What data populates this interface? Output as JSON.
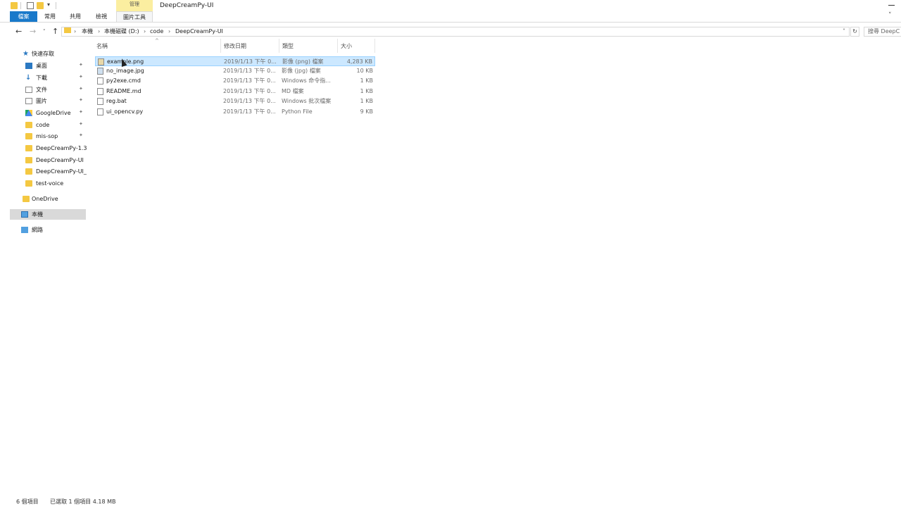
{
  "window": {
    "title": "DeepCreamPy-UI",
    "context_tab_label": "管理"
  },
  "ribbon": {
    "tabs": [
      {
        "label": "檔案"
      },
      {
        "label": "常用"
      },
      {
        "label": "共用"
      },
      {
        "label": "檢視"
      },
      {
        "label": "圖片工具"
      }
    ]
  },
  "address": {
    "breadcrumbs": [
      {
        "label": "本機"
      },
      {
        "label": "本機磁碟 (D:)"
      },
      {
        "label": "code"
      },
      {
        "label": "DeepCreamPy-UI"
      }
    ],
    "search_placeholder": "搜尋 DeepC"
  },
  "nav": {
    "quick_access": "快速存取",
    "items": [
      {
        "label": "桌面",
        "icon": "desktop-icon",
        "pinned": true
      },
      {
        "label": "下載",
        "icon": "download-icon",
        "pinned": true
      },
      {
        "label": "文件",
        "icon": "document-icon",
        "pinned": true
      },
      {
        "label": "圖片",
        "icon": "pictures-icon",
        "pinned": true
      },
      {
        "label": "GoogleDrive",
        "icon": "google-drive-icon",
        "pinned": true
      },
      {
        "label": "code",
        "icon": "folder-icon",
        "pinned": true
      },
      {
        "label": "mis-sop",
        "icon": "folder-icon",
        "pinned": true
      },
      {
        "label": "DeepCreamPy-1.3",
        "icon": "folder-icon",
        "pinned": false
      },
      {
        "label": "DeepCreamPy-UI",
        "icon": "folder-icon",
        "pinned": false
      },
      {
        "label": "DeepCreamPy-UI_",
        "icon": "folder-icon",
        "pinned": false
      },
      {
        "label": "test-voice",
        "icon": "folder-icon",
        "pinned": false
      }
    ],
    "onedrive": "OneDrive",
    "this_pc": "本機",
    "network": "網路"
  },
  "columns": {
    "name": "名稱",
    "modified": "修改日期",
    "type": "類型",
    "size": "大小"
  },
  "files": [
    {
      "name": "example.png",
      "modified": "2019/1/13 下午 0...",
      "type": "影像 (png) 檔案",
      "size": "4,283 KB",
      "selected": true
    },
    {
      "name": "no_image.jpg",
      "modified": "2019/1/13 下午 0...",
      "type": "影像 (jpg) 檔案",
      "size": "10 KB"
    },
    {
      "name": "py2exe.cmd",
      "modified": "2019/1/13 下午 0...",
      "type": "Windows 命令指...",
      "size": "1 KB"
    },
    {
      "name": "README.md",
      "modified": "2019/1/13 下午 0...",
      "type": "MD 檔案",
      "size": "1 KB"
    },
    {
      "name": "reg.bat",
      "modified": "2019/1/13 下午 0...",
      "type": "Windows 批次檔案",
      "size": "1 KB"
    },
    {
      "name": "ui_opencv.py",
      "modified": "2019/1/13 下午 0...",
      "type": "Python File",
      "size": "9 KB"
    }
  ],
  "status": {
    "item_count": "6 個項目",
    "selection": "已選取 1 個項目  4.18 MB"
  },
  "colors": {
    "accent": "#1979ca",
    "selection_bg": "#cce8ff",
    "selection_border": "#99d1ff",
    "context_tab": "#fbeea0",
    "folder": "#f4c842"
  }
}
